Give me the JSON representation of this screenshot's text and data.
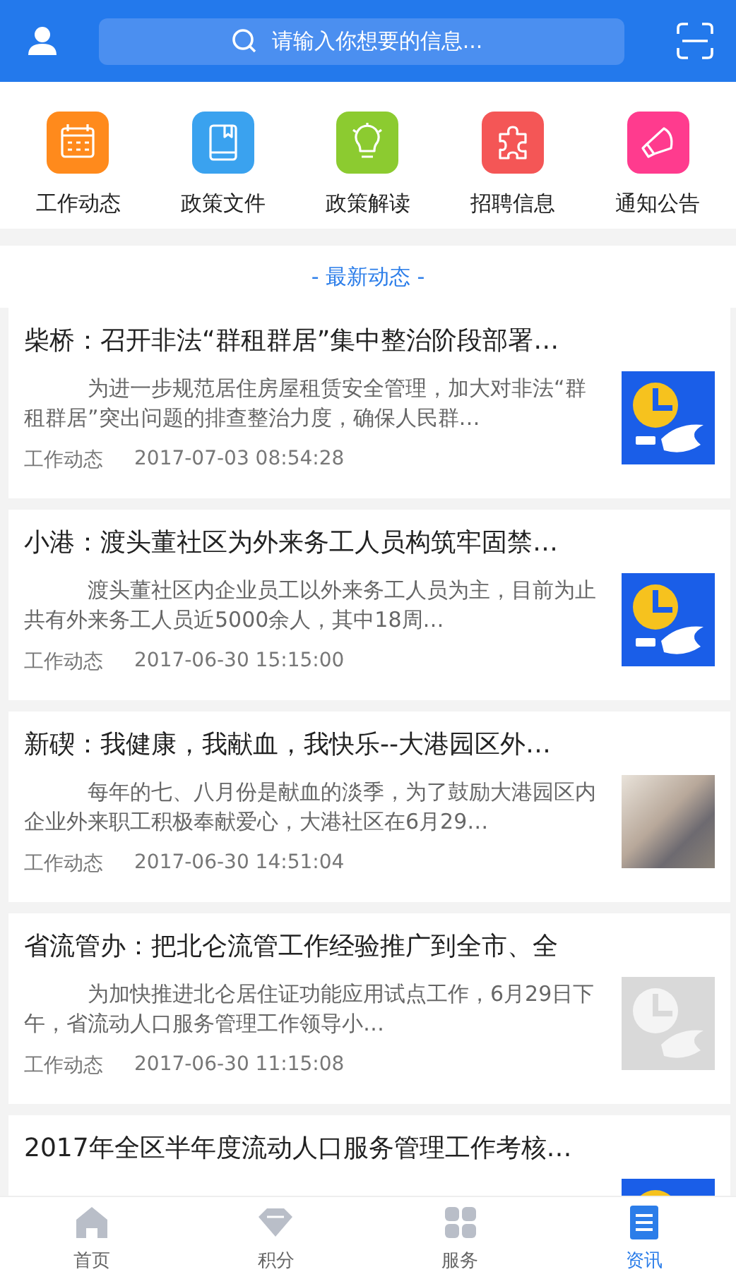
{
  "header": {
    "search": {
      "placeholder": "请输入你想要的信息..."
    }
  },
  "categories": [
    {
      "label": "工作动态",
      "color": "#ff8a1c"
    },
    {
      "label": "政策文件",
      "color": "#3aa2ef"
    },
    {
      "label": "政策解读",
      "color": "#8ccb30"
    },
    {
      "label": "招聘信息",
      "color": "#f45656"
    },
    {
      "label": "通知公告",
      "color": "#ff3b8e"
    }
  ],
  "section_title": "- 最新动态 -",
  "news": [
    {
      "title": "柴桥：召开非法“群租群居”集中整治阶段部署…",
      "summary": "为进一步规范居住房屋租赁安全管理，加大对非法“群租群居”突出问题的排查整治力度，确保人民群…",
      "category": "工作动态",
      "time": "2017-07-03 08:54:28",
      "kind": "logo"
    },
    {
      "title": "小港：渡头董社区为外来务工人员构筑牢固禁…",
      "summary": "渡头董社区内企业员工以外来务工人员为主，目前为止共有外来务工人员近5000余人，其中18周…",
      "category": "工作动态",
      "time": "2017-06-30 15:15:00",
      "kind": "logo"
    },
    {
      "title": "新碶：我健康，我献血，我快乐--大港园区外…",
      "summary": "每年的七、八月份是献血的淡季，为了鼓励大港园区内企业外来职工积极奉献爱心，大港社区在6月29…",
      "category": "工作动态",
      "time": "2017-06-30 14:51:04",
      "kind": "photo"
    },
    {
      "title": "省流管办：把北仑流管工作经验推广到全市、全",
      "summary": "为加快推进北仑居住证功能应用试点工作，6月29日下午，省流动人口服务管理工作领导小…",
      "category": "工作动态",
      "time": "2017-06-30 11:15:08",
      "kind": "logo-faded"
    },
    {
      "title": "2017年全区半年度流动人口服务管理工作考核…",
      "kind": "logo"
    }
  ],
  "tabs": [
    {
      "label": "首页",
      "selected": false
    },
    {
      "label": "积分",
      "selected": false
    },
    {
      "label": "服务",
      "selected": false
    },
    {
      "label": "资讯",
      "selected": true
    }
  ]
}
